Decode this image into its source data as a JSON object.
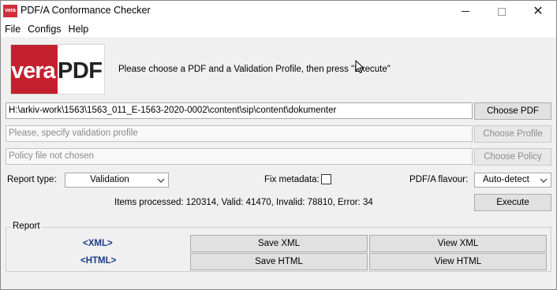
{
  "window": {
    "title": "PDF/A Conformance Checker",
    "app_icon_text": "vera"
  },
  "menu": [
    "File",
    "Configs",
    "Help"
  ],
  "logo": {
    "part1": "vera",
    "part2": "PDF"
  },
  "instructions": "Please choose a PDF and a Validation Profile, then press \"Execute\"",
  "pdf_path": {
    "value": "H:\\arkiv-work\\1563\\1563_011_E-1563-2020-0002\\content\\sip\\content\\dokumenter"
  },
  "profile_field": {
    "placeholder": "Please, specify validation profile"
  },
  "policy_field": {
    "placeholder": "Policy file not chosen"
  },
  "buttons": {
    "choose_pdf": "Choose PDF",
    "choose_profile": "Choose Profile",
    "choose_policy": "Choose Policy",
    "execute": "Execute",
    "save_xml": "Save XML",
    "view_xml": "View XML",
    "save_html": "Save HTML",
    "view_html": "View HTML"
  },
  "options": {
    "report_type_label": "Report type:",
    "report_type_value": "Validation",
    "fix_metadata_label": "Fix metadata:",
    "fix_metadata_checked": false,
    "flavour_label": "PDF/A flavour:",
    "flavour_value": "Auto-detect"
  },
  "stats": "Items processed: 120314, Valid: 41470, Invalid: 78810, Error: 34",
  "report": {
    "title": "Report",
    "xml_link": "<XML>",
    "html_link": "<HTML>"
  },
  "colors": {
    "brand_red": "#c3202e",
    "link_blue": "#1a3e8c"
  }
}
